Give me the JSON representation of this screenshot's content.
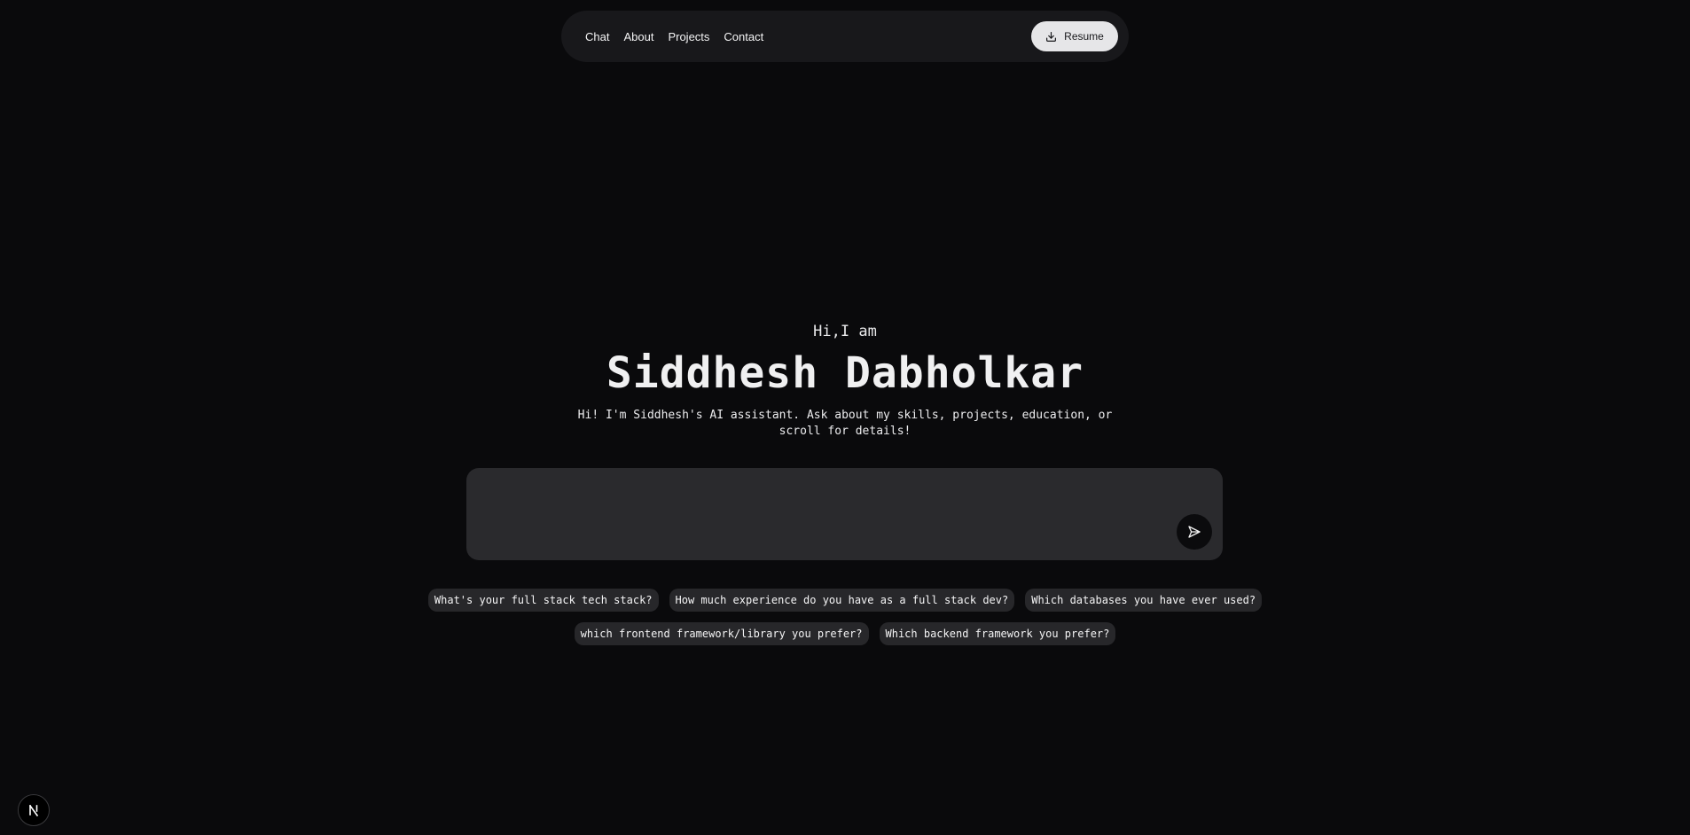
{
  "nav": {
    "links": [
      "Chat",
      "About",
      "Projects",
      "Contact"
    ],
    "resume_label": "Resume",
    "resume_icon": "download-icon"
  },
  "hero": {
    "greeting": "Hi,I am",
    "name": "Siddhesh Dabholkar",
    "subtitle": "Hi! I'm Siddhesh's AI assistant. Ask about my skills, projects, education, or scroll for details!"
  },
  "chat": {
    "input_value": "",
    "send_icon": "send-icon"
  },
  "suggestions": [
    "What's your full stack tech stack?",
    "How much experience do you have as a full stack dev?",
    "Which databases you have ever used?",
    "which frontend framework/library you prefer?",
    "Which backend framework you prefer?"
  ],
  "badge": {
    "icon": "nextjs-logo-icon"
  },
  "colors": {
    "background": "#0a0a0c",
    "navbar": "#18181b",
    "resume_button": "#e6e6e8",
    "chat_box": "#2a2a2d",
    "chip": "#27272a"
  }
}
